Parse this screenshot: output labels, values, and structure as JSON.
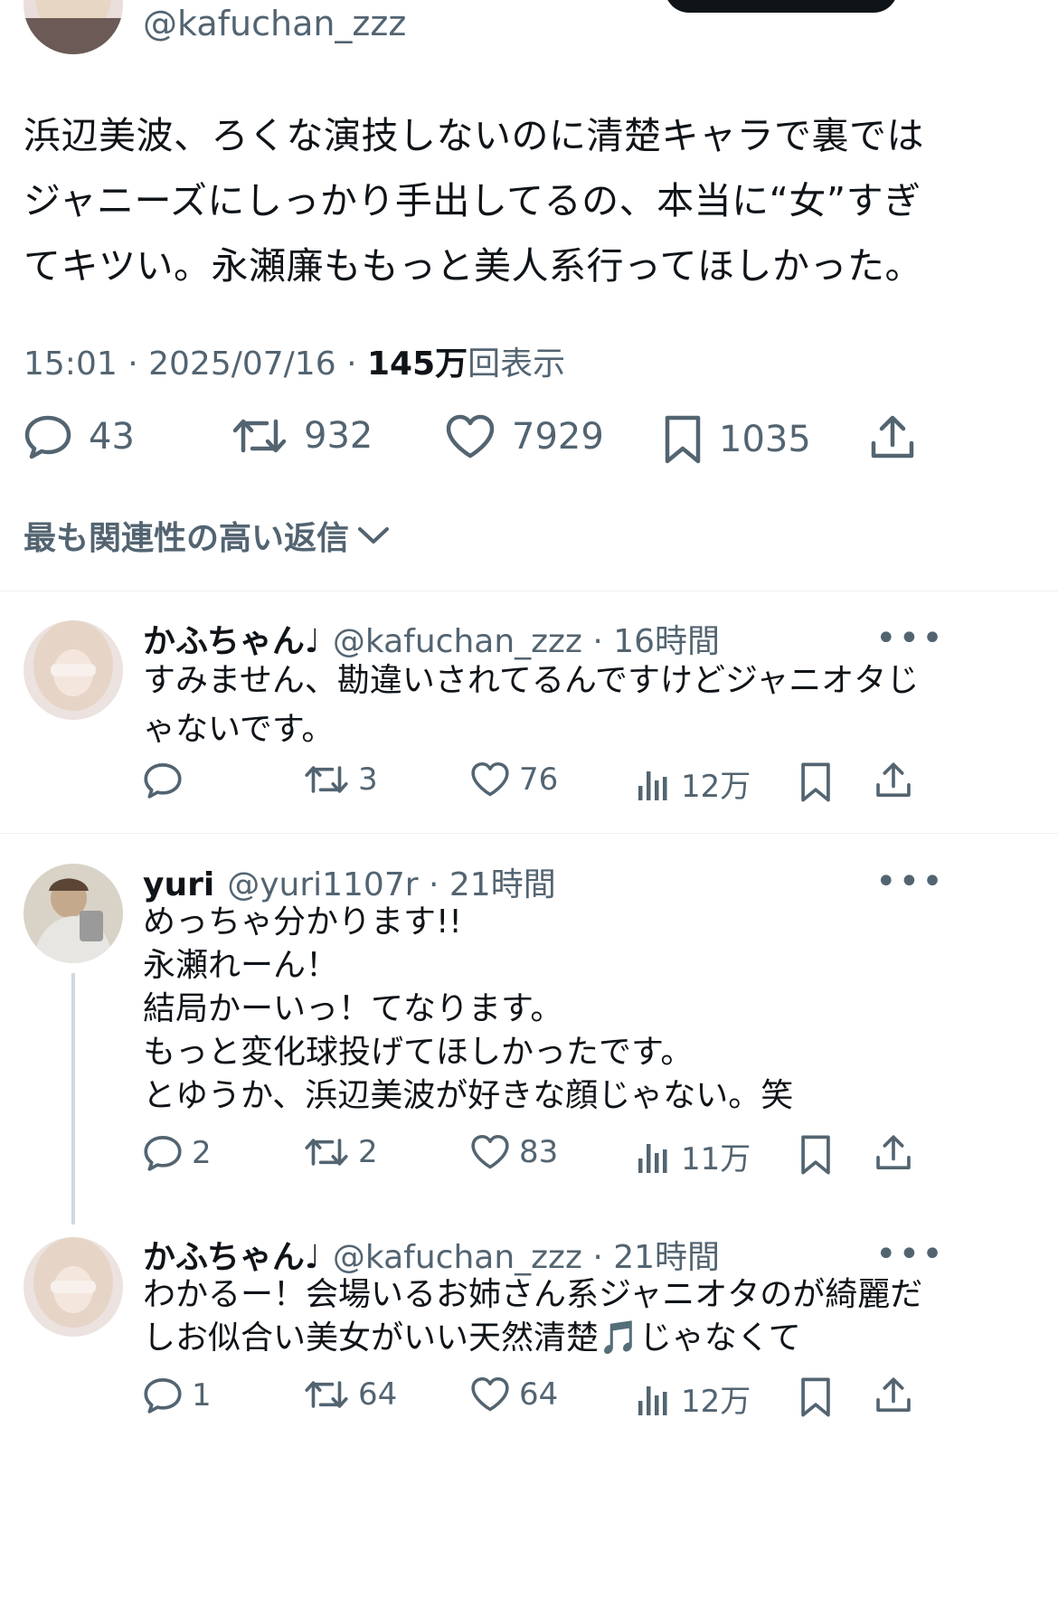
{
  "post": {
    "handle": "@kafuchan_zzz",
    "text_lines": [
      "浜辺美波、ろくな演技しないのに清楚キャラで裏では",
      "ジャニーズにしっかり手出してるの、本当に“女”すぎ",
      "てキツい。永瀬廉ももっと美人系行ってほしかった。"
    ],
    "time": "15:01",
    "date": "2025/07/16",
    "views_count": "145万",
    "views_label": "回表示",
    "replies": "43",
    "reposts": "932",
    "likes": "7929",
    "bookmarks": "1035"
  },
  "sort_label": "最も関連性の高い返信",
  "replies": [
    {
      "name": "かふちゃん♩",
      "handle": "@kafuchan_zzz",
      "time": "16時間",
      "text_lines": [
        "すみません、勘違いされてるんですけどジャニオタじ",
        "ゃないです。"
      ],
      "replies": "",
      "reposts": "3",
      "likes": "76",
      "views": "12万"
    },
    {
      "name": "yuri",
      "handle": "@yuri1107r",
      "time": "21時間",
      "text_lines": [
        "めっちゃ分かります!!",
        "永瀬れーん！",
        "結局かーいっ！てなります。",
        "もっと変化球投げてほしかったです。",
        "とゆうか、浜辺美波が好きな顔じゃない。笑"
      ],
      "replies": "2",
      "reposts": "2",
      "likes": "83",
      "views": "11万"
    },
    {
      "name": "かふちゃん♩",
      "handle": "@kafuchan_zzz",
      "time": "21時間",
      "text_lines": [
        "わかるー！会場いるお姉さん系ジャニオタのが綺麗だ",
        "しお似合い美女がいい天然清楚🎵じゃなくて"
      ],
      "replies": "1",
      "reposts": "64",
      "likes": "64",
      "views": "12万"
    }
  ],
  "dot_sep": "·",
  "colors": {
    "text": "#0f1419",
    "secondary": "#536471",
    "divider": "#eff3f4",
    "thread": "#cfd9de"
  }
}
